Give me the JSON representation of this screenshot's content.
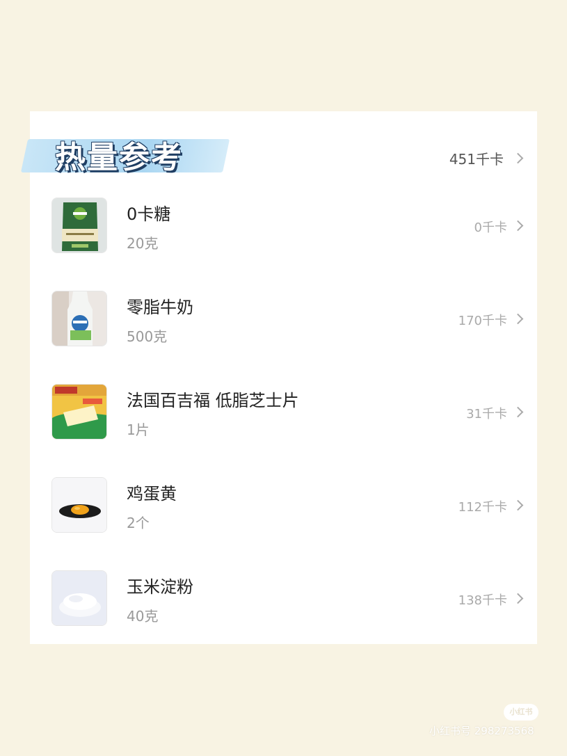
{
  "header": {
    "title": "热量参考",
    "total": "451千卡"
  },
  "items": [
    {
      "name": "0卡糖",
      "qty": "20克",
      "kcal": "0千卡",
      "thumb_icon": "sweetener-pouch-icon"
    },
    {
      "name": "零脂牛奶",
      "qty": "500克",
      "kcal": "170千卡",
      "thumb_icon": "milk-bottle-icon"
    },
    {
      "name": "法国百吉福 低脂芝士片",
      "qty": "1片",
      "kcal": "31千卡",
      "thumb_icon": "cheese-pack-icon"
    },
    {
      "name": "鸡蛋黄",
      "qty": "2个",
      "kcal": "112千卡",
      "thumb_icon": "egg-yolk-icon"
    },
    {
      "name": "玉米淀粉",
      "qty": "40克",
      "kcal": "138千卡",
      "thumb_icon": "cornstarch-bowl-icon"
    }
  ],
  "watermark": {
    "logo": "小红书",
    "text": "小红书号 298273568"
  },
  "colors": {
    "background": "#f8f3e3",
    "card": "#ffffff",
    "title_highlight": "#a9d6f2",
    "title_outline": "#1f3e63"
  }
}
